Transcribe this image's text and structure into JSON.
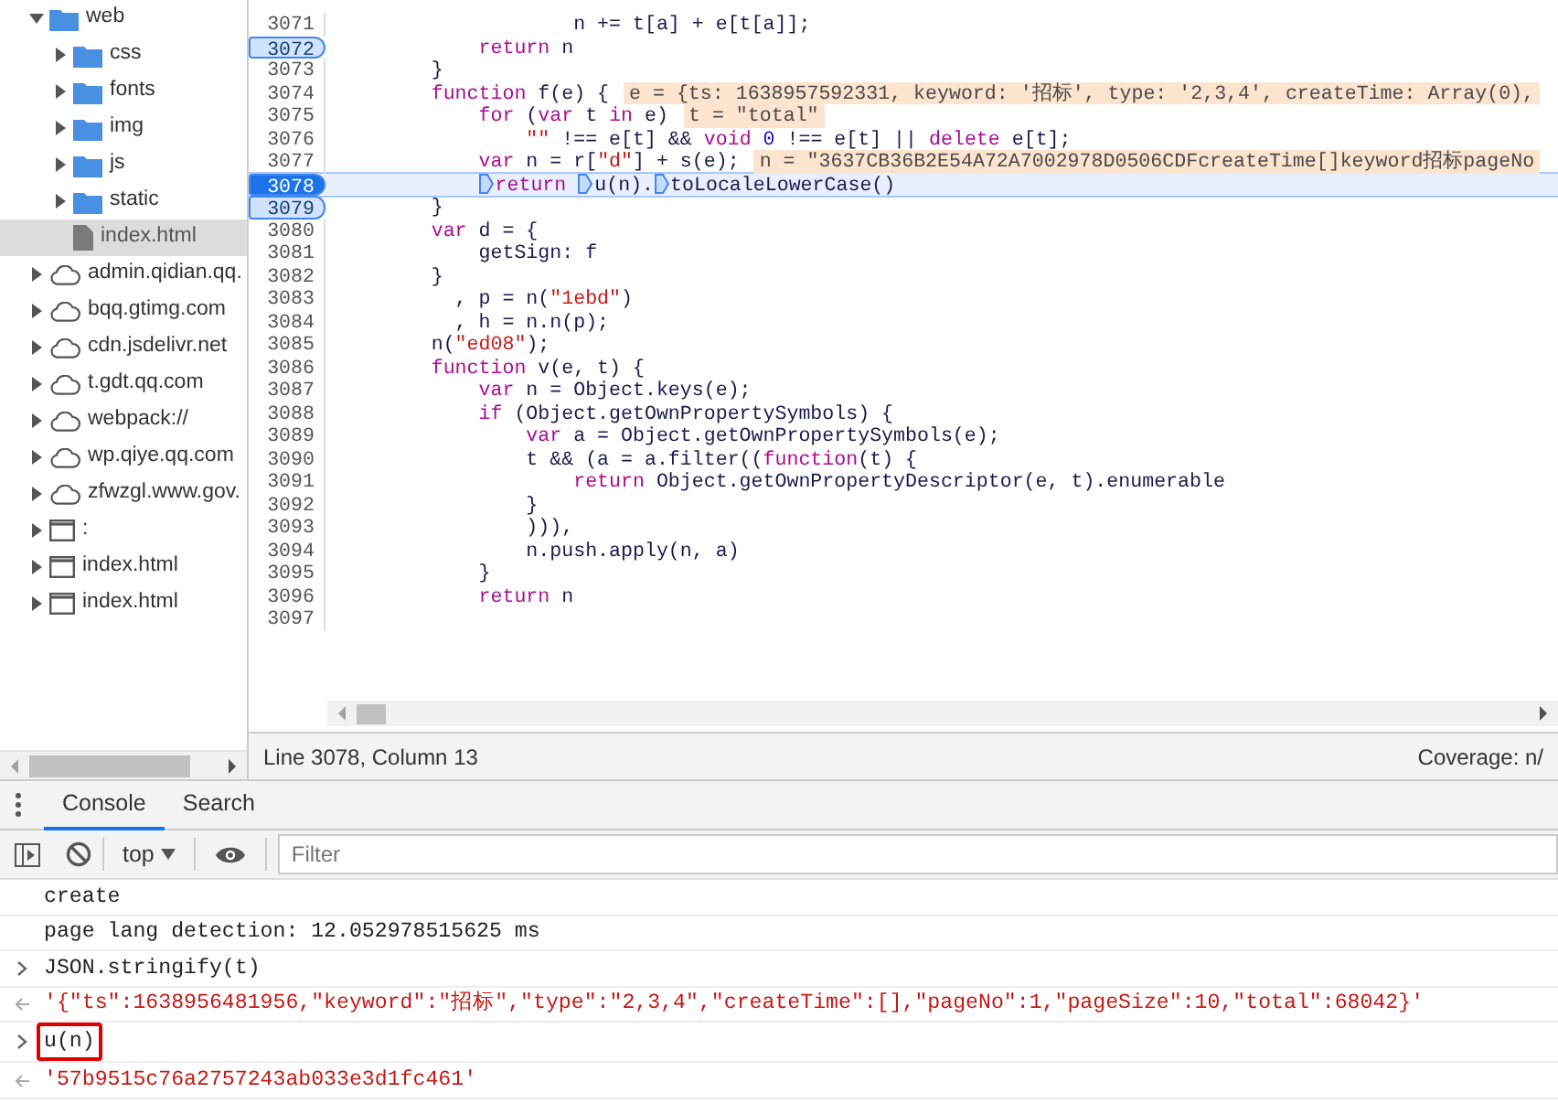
{
  "sources_tree": [
    {
      "label": "web",
      "kind": "folder",
      "expanded": true,
      "selected": false,
      "children": [
        {
          "label": "css",
          "kind": "folder",
          "expanded": false,
          "selected": false
        },
        {
          "label": "fonts",
          "kind": "folder",
          "expanded": false,
          "selected": false
        },
        {
          "label": "img",
          "kind": "folder",
          "expanded": false,
          "selected": false
        },
        {
          "label": "js",
          "kind": "folder",
          "expanded": false,
          "selected": false
        },
        {
          "label": "static",
          "kind": "folder",
          "expanded": false,
          "selected": false
        },
        {
          "label": "index.html",
          "kind": "file",
          "selected": true
        }
      ]
    },
    {
      "label": "admin.qidian.qq.",
      "kind": "domain",
      "expanded": false,
      "selected": false
    },
    {
      "label": "bqq.gtimg.com",
      "kind": "domain",
      "expanded": false,
      "selected": false
    },
    {
      "label": "cdn.jsdelivr.net",
      "kind": "domain",
      "expanded": false,
      "selected": false
    },
    {
      "label": "t.gdt.qq.com",
      "kind": "domain",
      "expanded": false,
      "selected": false
    },
    {
      "label": "webpack://",
      "kind": "domain",
      "expanded": false,
      "selected": false
    },
    {
      "label": "wp.qiye.qq.com",
      "kind": "domain",
      "expanded": false,
      "selected": false
    },
    {
      "label": "zfwzgl.www.gov.",
      "kind": "domain",
      "expanded": false,
      "selected": false
    },
    {
      "label": ":",
      "kind": "frame",
      "expanded": false,
      "selected": false
    },
    {
      "label": "index.html",
      "kind": "frame",
      "expanded": false,
      "selected": false
    },
    {
      "label": "index.html",
      "kind": "frame",
      "expanded": false,
      "selected": false
    }
  ],
  "editor": {
    "lines": [
      {
        "number": "3071",
        "breakpoint": false,
        "current": false,
        "tokens": [
          {
            "kind": "plain",
            "text": "                    n += t[a] + e[t[a]];"
          }
        ]
      },
      {
        "number": "3072",
        "breakpoint": true,
        "current": false,
        "tokens": [
          {
            "kind": "keyword",
            "text": "            return"
          },
          {
            "kind": "plain",
            "text": " n"
          }
        ]
      },
      {
        "number": "3073",
        "breakpoint": false,
        "current": false,
        "tokens": [
          {
            "kind": "plain",
            "text": "        }"
          }
        ]
      },
      {
        "number": "3074",
        "breakpoint": false,
        "current": false,
        "tokens": [
          {
            "kind": "keyword",
            "text": "        function"
          },
          {
            "kind": "plain",
            "text": " f(e) {"
          },
          {
            "kind": "inline",
            "text": "e = {ts: 1638957592331, keyword: '招标', type: '2,3,4', createTime: Array(0),"
          }
        ]
      },
      {
        "number": "3075",
        "breakpoint": false,
        "current": false,
        "tokens": [
          {
            "kind": "keyword",
            "text": "            for"
          },
          {
            "kind": "plain",
            "text": " ("
          },
          {
            "kind": "keyword",
            "text": "var"
          },
          {
            "kind": "plain",
            "text": " t "
          },
          {
            "kind": "keyword",
            "text": "in"
          },
          {
            "kind": "plain",
            "text": " e)"
          },
          {
            "kind": "inline",
            "text": "t = \"total\""
          }
        ]
      },
      {
        "number": "3076",
        "breakpoint": false,
        "current": false,
        "tokens": [
          {
            "kind": "string",
            "text": "                \"\""
          },
          {
            "kind": "plain",
            "text": " !== e[t] && "
          },
          {
            "kind": "keyword",
            "text": "void"
          },
          {
            "kind": "number",
            "text": " 0"
          },
          {
            "kind": "plain",
            "text": " !== e[t] || "
          },
          {
            "kind": "keyword",
            "text": "delete"
          },
          {
            "kind": "plain",
            "text": " e[t];"
          }
        ]
      },
      {
        "number": "3077",
        "breakpoint": false,
        "current": false,
        "tokens": [
          {
            "kind": "keyword",
            "text": "            var"
          },
          {
            "kind": "plain",
            "text": " n = r["
          },
          {
            "kind": "string",
            "text": "\"d\""
          },
          {
            "kind": "plain",
            "text": "] + s(e);"
          },
          {
            "kind": "inline",
            "text": "n = \"3637CB36B2E54A72A7002978D0506CDFcreateTime[]keyword招标pageNo"
          }
        ]
      },
      {
        "number": "3078",
        "breakpoint": true,
        "current": true,
        "tokens": [
          {
            "kind": "stop-keyword",
            "text": "            return "
          },
          {
            "kind": "stop-plain",
            "text": "u(n)."
          },
          {
            "kind": "stop-plain",
            "text": "toLocaleLowerCase()"
          }
        ]
      },
      {
        "number": "3079",
        "breakpoint": true,
        "current": false,
        "tokens": [
          {
            "kind": "plain",
            "text": "        }"
          }
        ]
      },
      {
        "number": "3080",
        "breakpoint": false,
        "current": false,
        "tokens": [
          {
            "kind": "keyword",
            "text": "        var"
          },
          {
            "kind": "plain",
            "text": " d = {"
          }
        ]
      },
      {
        "number": "3081",
        "breakpoint": false,
        "current": false,
        "tokens": [
          {
            "kind": "plain",
            "text": "            getSign: f"
          }
        ]
      },
      {
        "number": "3082",
        "breakpoint": false,
        "current": false,
        "tokens": [
          {
            "kind": "plain",
            "text": "        }"
          }
        ]
      },
      {
        "number": "3083",
        "breakpoint": false,
        "current": false,
        "tokens": [
          {
            "kind": "plain",
            "text": "          , p = n("
          },
          {
            "kind": "string",
            "text": "\"1ebd\""
          },
          {
            "kind": "plain",
            "text": ")"
          }
        ]
      },
      {
        "number": "3084",
        "breakpoint": false,
        "current": false,
        "tokens": [
          {
            "kind": "plain",
            "text": "          , h = n.n(p);"
          }
        ]
      },
      {
        "number": "3085",
        "breakpoint": false,
        "current": false,
        "tokens": [
          {
            "kind": "plain",
            "text": "        n("
          },
          {
            "kind": "string",
            "text": "\"ed08\""
          },
          {
            "kind": "plain",
            "text": ");"
          }
        ]
      },
      {
        "number": "3086",
        "breakpoint": false,
        "current": false,
        "tokens": [
          {
            "kind": "keyword",
            "text": "        function"
          },
          {
            "kind": "plain",
            "text": " v(e, t) {"
          }
        ]
      },
      {
        "number": "3087",
        "breakpoint": false,
        "current": false,
        "tokens": [
          {
            "kind": "keyword",
            "text": "            var"
          },
          {
            "kind": "plain",
            "text": " n = Object.keys(e);"
          }
        ]
      },
      {
        "number": "3088",
        "breakpoint": false,
        "current": false,
        "tokens": [
          {
            "kind": "keyword",
            "text": "            if"
          },
          {
            "kind": "plain",
            "text": " (Object.getOwnPropertySymbols) {"
          }
        ]
      },
      {
        "number": "3089",
        "breakpoint": false,
        "current": false,
        "tokens": [
          {
            "kind": "keyword",
            "text": "                var"
          },
          {
            "kind": "plain",
            "text": " a = Object.getOwnPropertySymbols(e);"
          }
        ]
      },
      {
        "number": "3090",
        "breakpoint": false,
        "current": false,
        "tokens": [
          {
            "kind": "plain",
            "text": "                t && (a = a.filter(("
          },
          {
            "kind": "keyword",
            "text": "function"
          },
          {
            "kind": "plain",
            "text": "(t) {"
          }
        ]
      },
      {
        "number": "3091",
        "breakpoint": false,
        "current": false,
        "tokens": [
          {
            "kind": "keyword",
            "text": "                    return"
          },
          {
            "kind": "plain",
            "text": " Object.getOwnPropertyDescriptor(e, t).enumerable"
          }
        ]
      },
      {
        "number": "3092",
        "breakpoint": false,
        "current": false,
        "tokens": [
          {
            "kind": "plain",
            "text": "                }"
          }
        ]
      },
      {
        "number": "3093",
        "breakpoint": false,
        "current": false,
        "tokens": [
          {
            "kind": "plain",
            "text": "                ))),"
          }
        ]
      },
      {
        "number": "3094",
        "breakpoint": false,
        "current": false,
        "tokens": [
          {
            "kind": "plain",
            "text": "                n.push.apply(n, a)"
          }
        ]
      },
      {
        "number": "3095",
        "breakpoint": false,
        "current": false,
        "tokens": [
          {
            "kind": "plain",
            "text": "            }"
          }
        ]
      },
      {
        "number": "3096",
        "breakpoint": false,
        "current": false,
        "tokens": [
          {
            "kind": "keyword",
            "text": "            return"
          },
          {
            "kind": "plain",
            "text": " n"
          }
        ]
      },
      {
        "number": "3097",
        "breakpoint": false,
        "current": false
      }
    ]
  },
  "status_bar": {
    "position": "Line 3078, Column 13",
    "coverage": "Coverage: n/"
  },
  "drawer": {
    "tabs": [
      {
        "label": "Console",
        "selected": true
      },
      {
        "label": "Search",
        "selected": false
      }
    ]
  },
  "console": {
    "context": "top",
    "filter": {
      "placeholder": "Filter"
    },
    "messages": [
      {
        "kind": "log",
        "text": "create",
        "highlighted": false
      },
      {
        "kind": "log",
        "text": "page lang detection: 12.052978515625 ms",
        "highlighted": false
      },
      {
        "kind": "input",
        "text": "JSON.stringify(t)",
        "highlighted": false
      },
      {
        "kind": "result",
        "text": "'{\"ts\":1638956481956,\"keyword\":\"招标\",\"type\":\"2,3,4\",\"createTime\":[],\"pageNo\":1,\"pageSize\":10,\"total\":68042}'",
        "highlighted": false
      },
      {
        "kind": "input",
        "text": "u(n)",
        "highlighted": true
      },
      {
        "kind": "result",
        "text": "'57b9515c76a2757243ab033e3d1fc461'",
        "highlighted": false
      }
    ]
  }
}
